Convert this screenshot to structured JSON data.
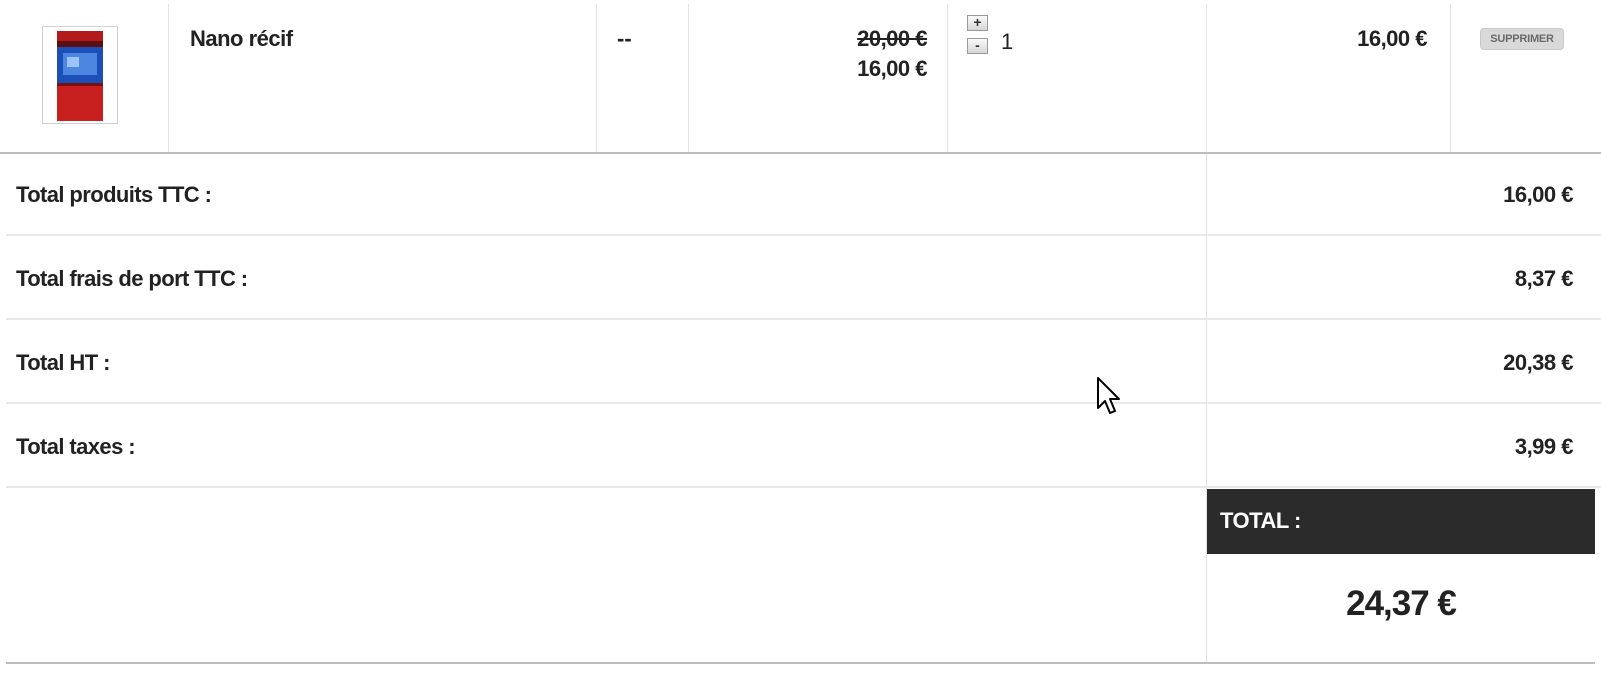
{
  "product": {
    "name": "Nano récif",
    "reference": "--",
    "old_price": "20,00 €",
    "new_price": "16,00 €",
    "quantity": "1",
    "plus_label": "+",
    "minus_label": "-",
    "line_total": "16,00 €",
    "delete_label": "SUPPRIMER",
    "thumbnail_icon": "aquarium-product-image"
  },
  "totals": [
    {
      "label": "Total produits TTC :",
      "value": "16,00 €"
    },
    {
      "label": "Total frais de port TTC :",
      "value": "8,37 €"
    },
    {
      "label": "Total HT :",
      "value": "20,38 €"
    },
    {
      "label": "Total taxes :",
      "value": "3,99 €"
    }
  ],
  "grand_total": {
    "label": "TOTAL :",
    "value": "24,37 €"
  },
  "colors": {
    "header_bg": "#2b2b2b",
    "border": "#bdbdbd"
  }
}
